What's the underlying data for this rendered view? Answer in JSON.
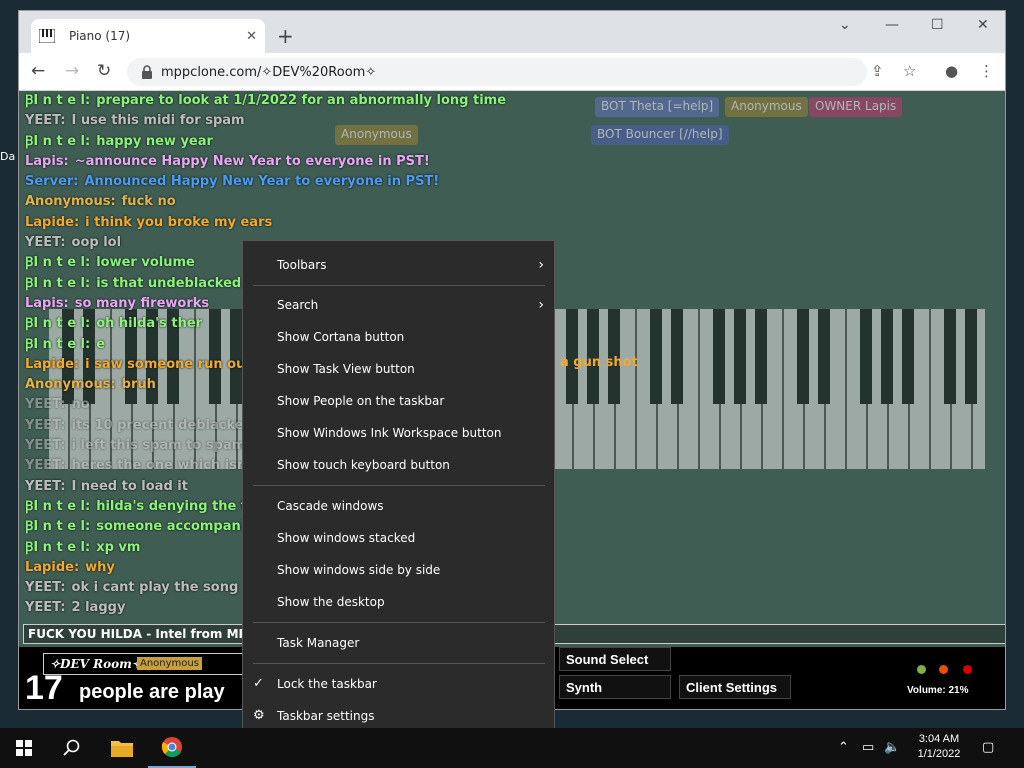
{
  "browser": {
    "tab_title": "Piano (17)",
    "url": "mppclone.com/✧DEV%20Room✧",
    "new_tab_symbol": "+",
    "close_symbol": "✕"
  },
  "desktop": {
    "sliver_text": "Da"
  },
  "chat": {
    "messages": [
      {
        "name": "ꞴI n t e l:",
        "text": "prepare to look at 1/1/2022 for an abnormally long time",
        "ncolor": "#8df27b",
        "tcolor": "#8df27b"
      },
      {
        "name": "YEET:",
        "text": "I use this midi for spam",
        "ncolor": "#bdbdbd",
        "tcolor": "#bdbdbd"
      },
      {
        "name": "ꞴI n t e l:",
        "text": "happy new year",
        "ncolor": "#8df27b",
        "tcolor": "#8df27b"
      },
      {
        "name": "Lapis:",
        "text": "~announce Happy New Year to everyone in PST!",
        "ncolor": "#e9a6f5",
        "tcolor": "#e9a6f5"
      },
      {
        "name": "Server:",
        "text": "Announced Happy New Year to everyone in PST!",
        "ncolor": "#4b9af3",
        "tcolor": "#4b9af3"
      },
      {
        "name": "Anonymous:",
        "text": "fuck no",
        "ncolor": "#e3b248",
        "tcolor": "#e3b248"
      },
      {
        "name": "Lapide:",
        "text": "i think you broke my ears",
        "ncolor": "#f0a931",
        "tcolor": "#f0a931"
      },
      {
        "name": "YEET:",
        "text": "oop lol",
        "ncolor": "#bdbdbd",
        "tcolor": "#bdbdbd"
      },
      {
        "name": "ꞴI n t e l:",
        "text": "lower volume",
        "ncolor": "#8df27b",
        "tcolor": "#8df27b"
      },
      {
        "name": "ꞴI n t e l:",
        "text": "is that undeblacked",
        "ncolor": "#8df27b",
        "tcolor": "#8df27b"
      },
      {
        "name": "Lapis:",
        "text": "so many fireworks",
        "ncolor": "#e9a6f5",
        "tcolor": "#e9a6f5"
      },
      {
        "name": "ꞴI n t e l:",
        "text": "oh hilda's ther",
        "ncolor": "#8df27b",
        "tcolor": "#8df27b"
      },
      {
        "name": "ꞴI n t e l:",
        "text": "e",
        "ncolor": "#8df27b",
        "tcolor": "#8df27b"
      },
      {
        "name": "Lapide:",
        "text": "i saw someone run out",
        "ncolor": "#f0a931",
        "tcolor": "#f0a931"
      },
      {
        "name": "Anonymous:",
        "text": "bruh",
        "ncolor": "#e3b248",
        "tcolor": "#e3b248"
      },
      {
        "name": "YEET:",
        "text": "no",
        "ncolor": "#bdbdbd",
        "tcolor": "#bdbdbd",
        "dim": true
      },
      {
        "name": "YEET:",
        "text": "its 10 precent deblacked",
        "ncolor": "#bdbdbd",
        "tcolor": "#bdbdbd",
        "dim": true
      },
      {
        "name": "YEET:",
        "text": "i left this spam to spam",
        "ncolor": "#bdbdbd",
        "tcolor": "#bdbdbd",
        "dim": true
      },
      {
        "name": "YEET:",
        "text": "heres the one which isnt",
        "ncolor": "#bdbdbd",
        "tcolor": "#bdbdbd",
        "dim": true
      },
      {
        "name": "YEET:",
        "text": "I need to load it",
        "ncolor": "#bdbdbd",
        "tcolor": "#bdbdbd"
      },
      {
        "name": "ꞴI n t e l:",
        "text": "hilda's denying the t",
        "ncolor": "#8df27b",
        "tcolor": "#8df27b"
      },
      {
        "name": "ꞴI n t e l:",
        "text": "someone accompani",
        "ncolor": "#8df27b",
        "tcolor": "#8df27b"
      },
      {
        "name": "ꞴI n t e l:",
        "text": "xp vm",
        "ncolor": "#8df27b",
        "tcolor": "#8df27b"
      },
      {
        "name": "Lapide:",
        "text": "why",
        "ncolor": "#f0a931",
        "tcolor": "#f0a931"
      },
      {
        "name": "YEET:",
        "text": "ok i cant play the song",
        "ncolor": "#bdbdbd",
        "tcolor": "#bdbdbd"
      },
      {
        "name": "YEET:",
        "text": "2 laggy",
        "ncolor": "#bdbdbd",
        "tcolor": "#bdbdbd"
      }
    ],
    "gun_shot_text": "a gun shot",
    "input_value": "FUCK YOU HILDA - Intel from MPP"
  },
  "users": [
    {
      "label": "BOT  Theta [=help]",
      "bg": "#5b6ea8"
    },
    {
      "label": "Anonymous",
      "bg": "#8a7a3a"
    },
    {
      "label": "OWNER  Lapis",
      "bg": "#a8406b"
    },
    {
      "label": "BOT  Bouncer [//help]",
      "bg": "#4a5fa0"
    },
    {
      "label": "Anonymous",
      "bg": "#8a7a3a"
    }
  ],
  "bottom": {
    "room_name": "✧DEV Room✧",
    "user_count": "17",
    "playing_text": "people are play",
    "anon_tag": "Anonymous",
    "sound_select": "Sound Select",
    "synth": "Synth",
    "client_settings": "Client Settings",
    "volume": "Volume: 21%"
  },
  "context_menu": {
    "items": [
      {
        "label": "Toolbars",
        "submenu": true
      },
      {
        "label": "Search",
        "submenu": true
      },
      {
        "label": "Show Cortana button"
      },
      {
        "label": "Show Task View button"
      },
      {
        "label": "Show People on the taskbar"
      },
      {
        "label": "Show Windows Ink Workspace button"
      },
      {
        "label": "Show touch keyboard button"
      },
      {
        "label": "Cascade windows"
      },
      {
        "label": "Show windows stacked"
      },
      {
        "label": "Show windows side by side"
      },
      {
        "label": "Show the desktop"
      },
      {
        "label": "Task Manager"
      },
      {
        "label": "Lock the taskbar",
        "checked": true
      },
      {
        "label": "Taskbar settings",
        "gear": true
      }
    ]
  },
  "taskbar": {
    "time": "3:04 AM",
    "date": "1/1/2022"
  },
  "colors": {
    "page_bg": "#3f5d52",
    "menu_bg": "#2b2b2b",
    "taskbar_bg": "#101010"
  }
}
